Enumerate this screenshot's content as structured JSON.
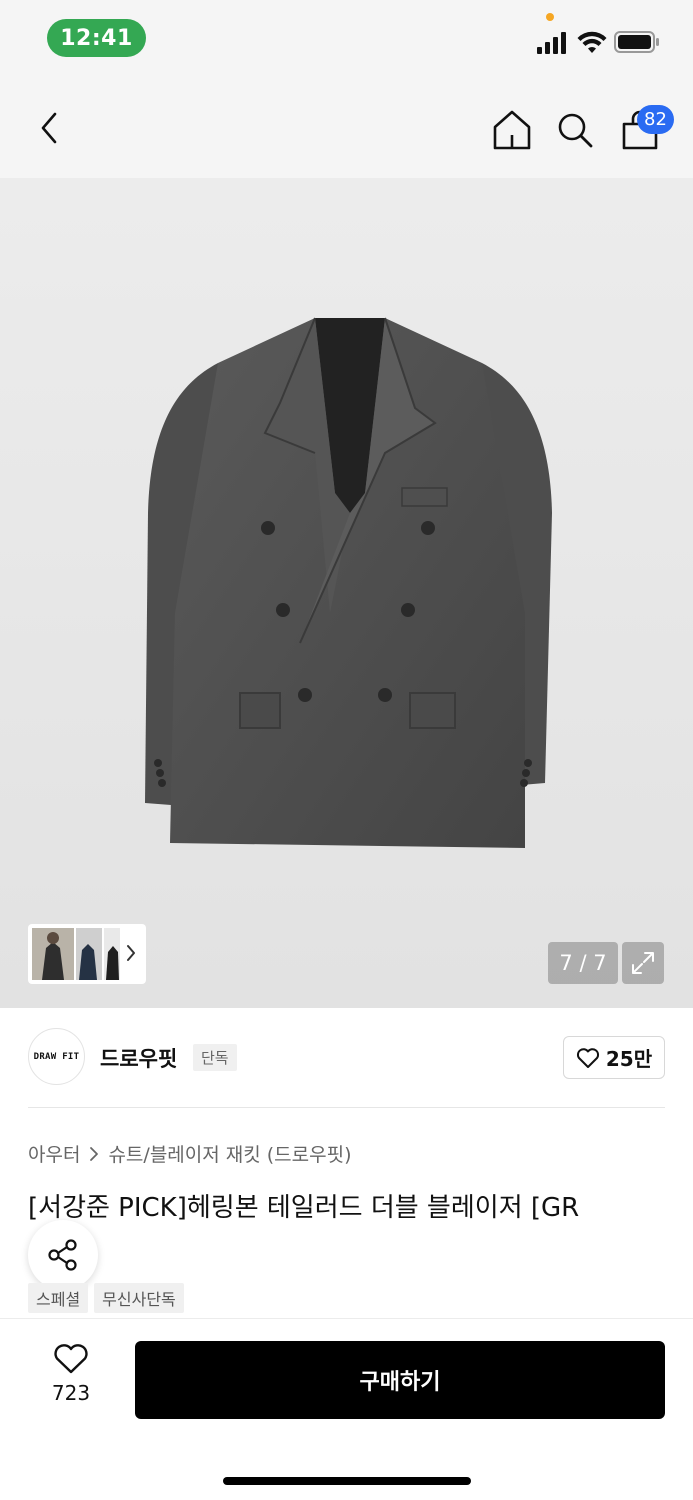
{
  "status_bar": {
    "time": "12:41"
  },
  "nav": {
    "cart_badge": "82"
  },
  "gallery": {
    "page_indicator": "7 / 7"
  },
  "brand": {
    "logo_text": "DRAW FIT",
    "name": "드로우핏",
    "tag": "단독",
    "likes": "25만"
  },
  "breadcrumb": {
    "category": "아우터",
    "subcategory": "슈트/블레이저 재킷 (드로우핏)"
  },
  "product": {
    "title": "[서강준 PICK]헤링본 테일러드 더블 블레이저 [GR",
    "tags": [
      "스페셜",
      "무신사단독"
    ]
  },
  "bottom": {
    "wish_count": "723",
    "buy_label": "구매하기"
  },
  "colors": {
    "accent_blue": "#2a6bf2",
    "time_pill_green": "#34a853",
    "buy_button": "#000000"
  }
}
